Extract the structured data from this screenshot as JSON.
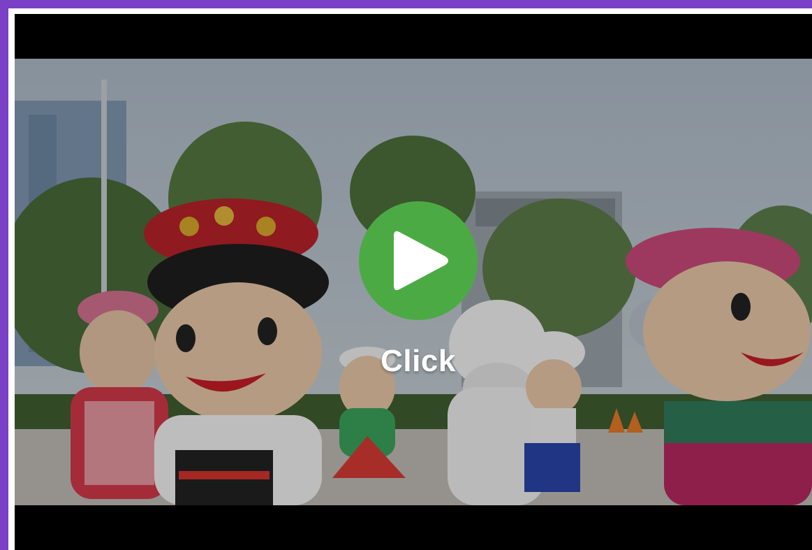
{
  "player": {
    "click_label": "Click",
    "accent_color": "#4caa45",
    "frame_color": "#7a41c6"
  },
  "icons": {
    "play": "play-icon"
  }
}
